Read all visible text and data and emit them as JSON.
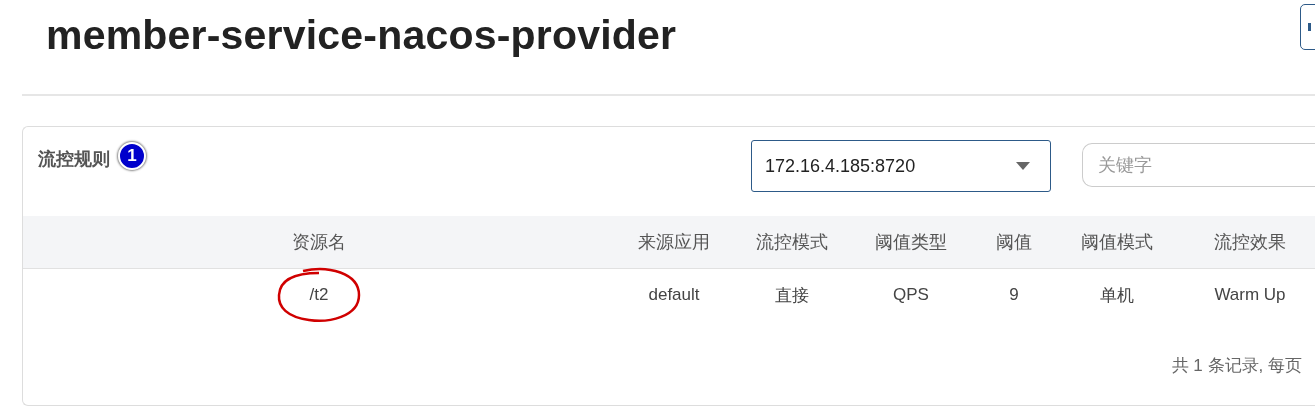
{
  "title": "member-service-nacos-provider",
  "card": {
    "title": "流控规则",
    "marker": "1",
    "machine_select": {
      "value": "172.16.4.185:8720"
    },
    "search": {
      "placeholder": "关键字"
    }
  },
  "table": {
    "columns": [
      "资源名",
      "来源应用",
      "流控模式",
      "阈值类型",
      "阈值",
      "阈值模式",
      "流控效果"
    ],
    "rows": [
      {
        "cells": [
          "/t2",
          "default",
          "直接",
          "QPS",
          "9",
          "单机",
          "Warm Up"
        ],
        "circled": true
      }
    ]
  },
  "footer": {
    "summary": "共 1 条记录, 每页"
  }
}
